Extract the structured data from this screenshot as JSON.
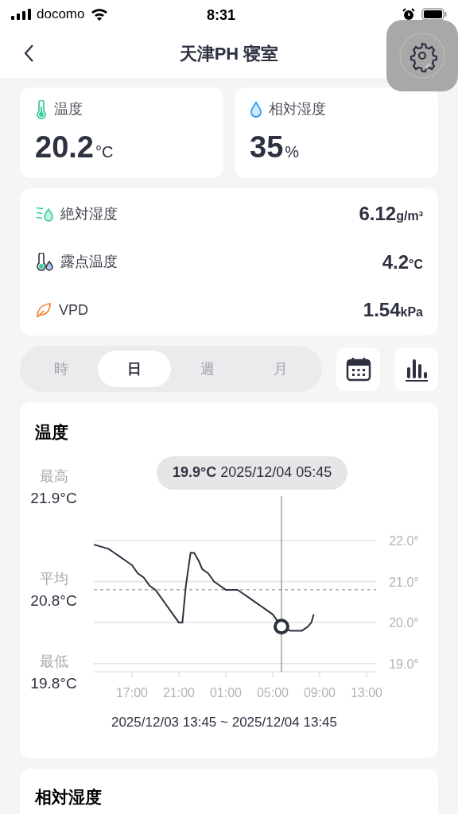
{
  "status_bar": {
    "carrier": "docomo",
    "time": "8:31"
  },
  "nav": {
    "title": "天津PH 寝室"
  },
  "summary": [
    {
      "kind": "temperature",
      "label": "温度",
      "value": "20.2",
      "unit": "°C"
    },
    {
      "kind": "humidity",
      "label": "相対湿度",
      "value": "35",
      "unit": "%"
    }
  ],
  "details": [
    {
      "kind": "absolute",
      "label": "絶対湿度",
      "value": "6.12",
      "unit": "g/m³"
    },
    {
      "kind": "dewpoint",
      "label": "露点温度",
      "value": "4.2",
      "unit": "°C"
    },
    {
      "kind": "vpd",
      "label": "VPD",
      "value": "1.54",
      "unit": "kPa"
    }
  ],
  "periods": [
    {
      "label": "時",
      "selected": false
    },
    {
      "label": "日",
      "selected": true
    },
    {
      "label": "週",
      "selected": false
    },
    {
      "label": "月",
      "selected": false
    }
  ],
  "temperature_card": {
    "stats": [
      {
        "label": "最高",
        "value": "21.9°C"
      },
      {
        "label": "平均",
        "value": "20.8°C"
      },
      {
        "label": "最低",
        "value": "19.8°C"
      }
    ],
    "chart_data": {
      "type": "line",
      "title": "温度",
      "grid": true,
      "xlim": [
        "2025-12-03T13:45",
        "2025-12-04T13:45"
      ],
      "ylim": [
        18.8,
        22
      ],
      "x": [
        "2025-12-03T13:45",
        "2025-12-03T15:00",
        "2025-12-03T15:30",
        "2025-12-03T16:00",
        "2025-12-03T16:30",
        "2025-12-03T17:00",
        "2025-12-03T17:30",
        "2025-12-03T18:00",
        "2025-12-03T18:30",
        "2025-12-03T19:00",
        "2025-12-03T19:30",
        "2025-12-03T20:00",
        "2025-12-03T20:30",
        "2025-12-03T21:00",
        "2025-12-03T21:18",
        "2025-12-03T21:36",
        "2025-12-03T22:00",
        "2025-12-03T22:18",
        "2025-12-03T22:42",
        "2025-12-03T23:00",
        "2025-12-03T23:30",
        "2025-12-04T00:00",
        "2025-12-04T00:30",
        "2025-12-04T01:00",
        "2025-12-04T02:00",
        "2025-12-04T02:30",
        "2025-12-04T03:00",
        "2025-12-04T03:30",
        "2025-12-04T04:00",
        "2025-12-04T04:30",
        "2025-12-04T05:00",
        "2025-12-04T05:30",
        "2025-12-04T05:45",
        "2025-12-04T06:30",
        "2025-12-04T07:30",
        "2025-12-04T08:00",
        "2025-12-04T08:18",
        "2025-12-04T08:30"
      ],
      "series": [
        {
          "color": "#2d3140",
          "values": [
            21.9,
            21.8,
            21.7,
            21.6,
            21.5,
            21.4,
            21.2,
            21.1,
            20.9,
            20.8,
            20.6,
            20.4,
            20.2,
            20.0,
            20.0,
            20.9,
            21.7,
            21.7,
            21.5,
            21.3,
            21.2,
            21.0,
            20.9,
            20.8,
            20.8,
            20.7,
            20.6,
            20.5,
            20.4,
            20.3,
            20.2,
            20.0,
            19.9,
            19.8,
            19.8,
            19.9,
            20.0,
            20.2
          ]
        }
      ],
      "xticks": [
        {
          "value": "2025-12-03T17:00",
          "label": "17:00"
        },
        {
          "value": "2025-12-03T21:00",
          "label": "21:00"
        },
        {
          "value": "2025-12-04T01:00",
          "label": "01:00"
        },
        {
          "value": "2025-12-04T05:00",
          "label": "05:00"
        },
        {
          "value": "2025-12-04T09:00",
          "label": "09:00"
        },
        {
          "value": "2025-12-04T13:00",
          "label": "13:00"
        }
      ],
      "yticks": [
        {
          "value": 22,
          "label": "22.0°"
        },
        {
          "value": 21,
          "label": "21.0°"
        },
        {
          "value": 20,
          "label": "20.0°"
        },
        {
          "value": 19,
          "label": "19.0°"
        }
      ],
      "ref_lines": [
        {
          "axis": "y",
          "value": 20.8
        },
        {
          "axis": "x",
          "value": "2025-12-04T05:45"
        }
      ],
      "annotations": [
        "19.9°C 2025/12/04 05:45"
      ]
    },
    "range": "2025/12/03 13:45 ~ 2025/12/04 13:45"
  },
  "humidity_card": {
    "title": "相対湿度"
  }
}
